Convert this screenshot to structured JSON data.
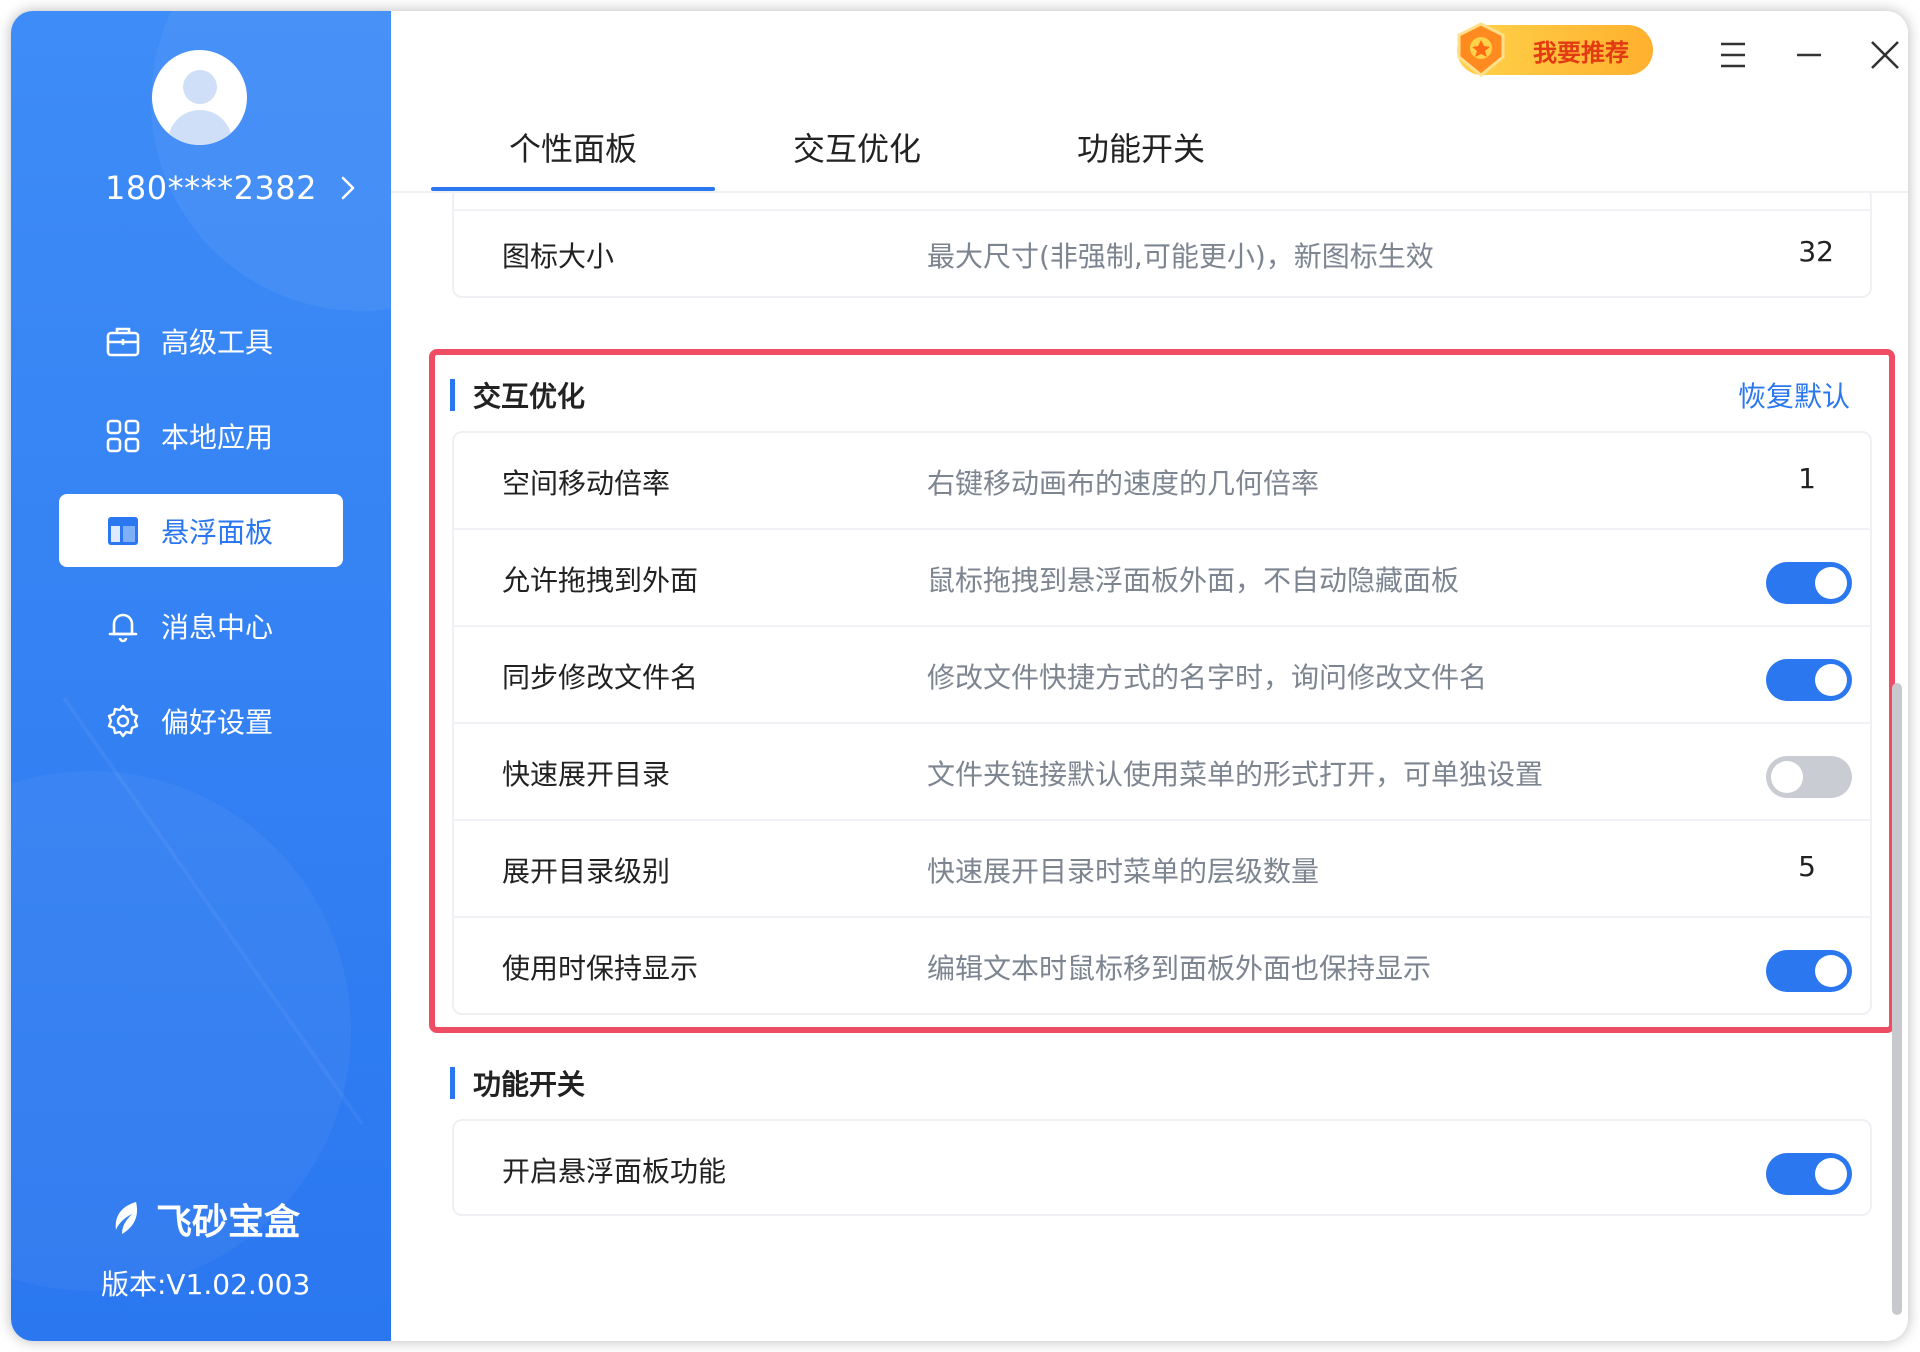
{
  "sidebar": {
    "username": "180****2382",
    "items": [
      {
        "label": "高级工具",
        "icon": "briefcase-icon"
      },
      {
        "label": "本地应用",
        "icon": "grid-icon"
      },
      {
        "label": "悬浮面板",
        "icon": "panel-icon",
        "active": true
      },
      {
        "label": "消息中心",
        "icon": "bell-icon"
      },
      {
        "label": "偏好设置",
        "icon": "gear-icon"
      }
    ],
    "brand": "飞砂宝盒",
    "version": "版本:V1.02.003"
  },
  "titlebar": {
    "recommend_label": "我要推荐"
  },
  "tabs": [
    "个性面板",
    "交互优化",
    "功能开关"
  ],
  "personal_panel": {
    "rows": [
      {
        "label": "图标大小",
        "desc": "最大尺寸(非强制,可能更小)，新图标生效",
        "value": "32"
      }
    ]
  },
  "interaction": {
    "title": "交互优化",
    "restore_label": "恢复默认",
    "rows": [
      {
        "label": "空间移动倍率",
        "desc": "右键移动画布的速度的几何倍率",
        "value": "1"
      },
      {
        "label": "允许拖拽到外面",
        "desc": "鼠标拖拽到悬浮面板外面，不自动隐藏面板",
        "toggle": true
      },
      {
        "label": "同步修改文件名",
        "desc": "修改文件快捷方式的名字时，询问修改文件名",
        "toggle": true
      },
      {
        "label": "快速展开目录",
        "desc": "文件夹链接默认使用菜单的形式打开，可单独设置",
        "toggle": false
      },
      {
        "label": "展开目录级别",
        "desc": "快速展开目录时菜单的层级数量",
        "value": "5"
      },
      {
        "label": "使用时保持显示",
        "desc": "编辑文本时鼠标移到面板外面也保持显示",
        "toggle": true
      }
    ]
  },
  "features": {
    "title": "功能开关",
    "rows": [
      {
        "label": "开启悬浮面板功能",
        "toggle": true
      }
    ]
  },
  "colors": {
    "accent": "#2a77f0",
    "highlight": "#ee4d63",
    "toggle_off": "#c9ccd2"
  }
}
